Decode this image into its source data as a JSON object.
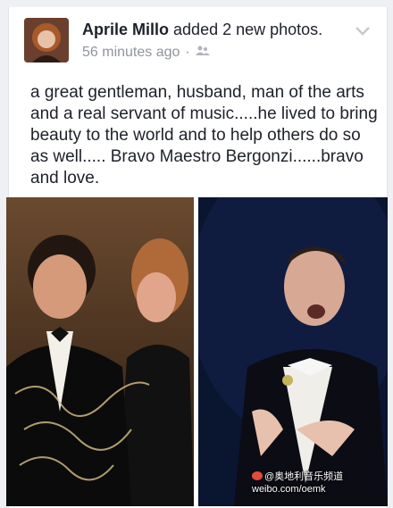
{
  "post": {
    "author_name": "Aprile Millo",
    "action_text": "added 2 new photos.",
    "timestamp": "56 minutes ago",
    "separator": "·",
    "audience_icon": "friends-icon",
    "menu_icon": "chevron-down-icon",
    "body": "a great gentleman, husband, man of the arts and a real servant of music.....he lived to bring beauty to the world and to help others do so as well..... Bravo Maestro Bergonzi......bravo and love."
  },
  "photos": [
    {
      "name": "photo-couple"
    },
    {
      "name": "photo-singer"
    }
  ],
  "watermark": {
    "line1": "@奥地利音乐频道",
    "line2": "weibo.com/oemk"
  },
  "colors": {
    "text": "#1d2129",
    "meta": "#90949c",
    "background": "#eef0f4"
  }
}
